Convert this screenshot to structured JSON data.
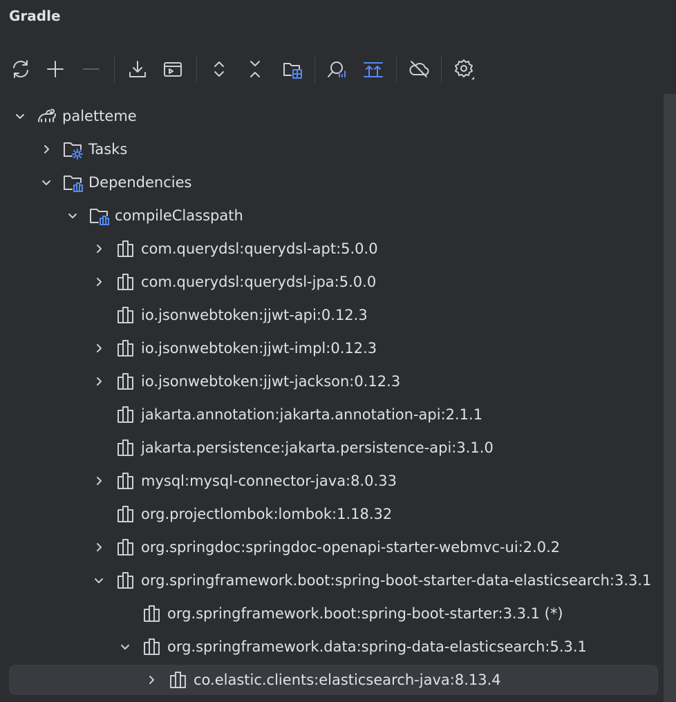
{
  "window": {
    "title": "Gradle"
  },
  "toolbar": {
    "buttons": [
      {
        "name": "reload-icon"
      },
      {
        "name": "add-icon"
      },
      {
        "name": "remove-icon"
      },
      {
        "name": "download-sources-icon"
      },
      {
        "name": "execute-task-icon"
      },
      {
        "name": "expand-all-icon"
      },
      {
        "name": "collapse-all-icon"
      },
      {
        "name": "group-modules-icon"
      },
      {
        "name": "analyze-dependencies-icon"
      },
      {
        "name": "toggle-offline-up-icon"
      },
      {
        "name": "offline-mode-icon"
      },
      {
        "name": "settings-icon"
      }
    ]
  },
  "tree": {
    "items": [
      {
        "label": "paletteme",
        "icon": "gradle-elephant-icon",
        "expanded": true
      },
      {
        "label": "Tasks",
        "icon": "tasks-folder-icon",
        "expanded": false
      },
      {
        "label": "Dependencies",
        "icon": "dependencies-folder-icon",
        "expanded": true
      },
      {
        "label": "compileClasspath",
        "icon": "dependencies-folder-icon",
        "expanded": true
      },
      {
        "label": "com.querydsl:querydsl-apt:5.0.0",
        "icon": "library-icon",
        "expanded": false
      },
      {
        "label": "com.querydsl:querydsl-jpa:5.0.0",
        "icon": "library-icon",
        "expanded": false
      },
      {
        "label": "io.jsonwebtoken:jjwt-api:0.12.3",
        "icon": "library-icon"
      },
      {
        "label": "io.jsonwebtoken:jjwt-impl:0.12.3",
        "icon": "library-icon",
        "expanded": false
      },
      {
        "label": "io.jsonwebtoken:jjwt-jackson:0.12.3",
        "icon": "library-icon",
        "expanded": false
      },
      {
        "label": "jakarta.annotation:jakarta.annotation-api:2.1.1",
        "icon": "library-icon"
      },
      {
        "label": "jakarta.persistence:jakarta.persistence-api:3.1.0",
        "icon": "library-icon"
      },
      {
        "label": "mysql:mysql-connector-java:8.0.33",
        "icon": "library-icon",
        "expanded": false
      },
      {
        "label": "org.projectlombok:lombok:1.18.32",
        "icon": "library-icon"
      },
      {
        "label": "org.springdoc:springdoc-openapi-starter-webmvc-ui:2.0.2",
        "icon": "library-icon",
        "expanded": false
      },
      {
        "label": "org.springframework.boot:spring-boot-starter-data-elasticsearch:3.3.1",
        "icon": "library-icon",
        "expanded": true
      },
      {
        "label": "org.springframework.boot:spring-boot-starter:3.3.1 (*)",
        "icon": "library-icon"
      },
      {
        "label": "org.springframework.data:spring-data-elasticsearch:5.3.1",
        "icon": "library-icon",
        "expanded": true
      },
      {
        "label": "co.elastic.clients:elasticsearch-java:8.13.4",
        "icon": "library-icon",
        "expanded": false,
        "selected": true
      }
    ]
  },
  "colors": {
    "background": "#2b2d30",
    "text": "#dfe1e5",
    "icon": "#ced0d6",
    "accent": "#548af7",
    "selection": "#393b40"
  }
}
